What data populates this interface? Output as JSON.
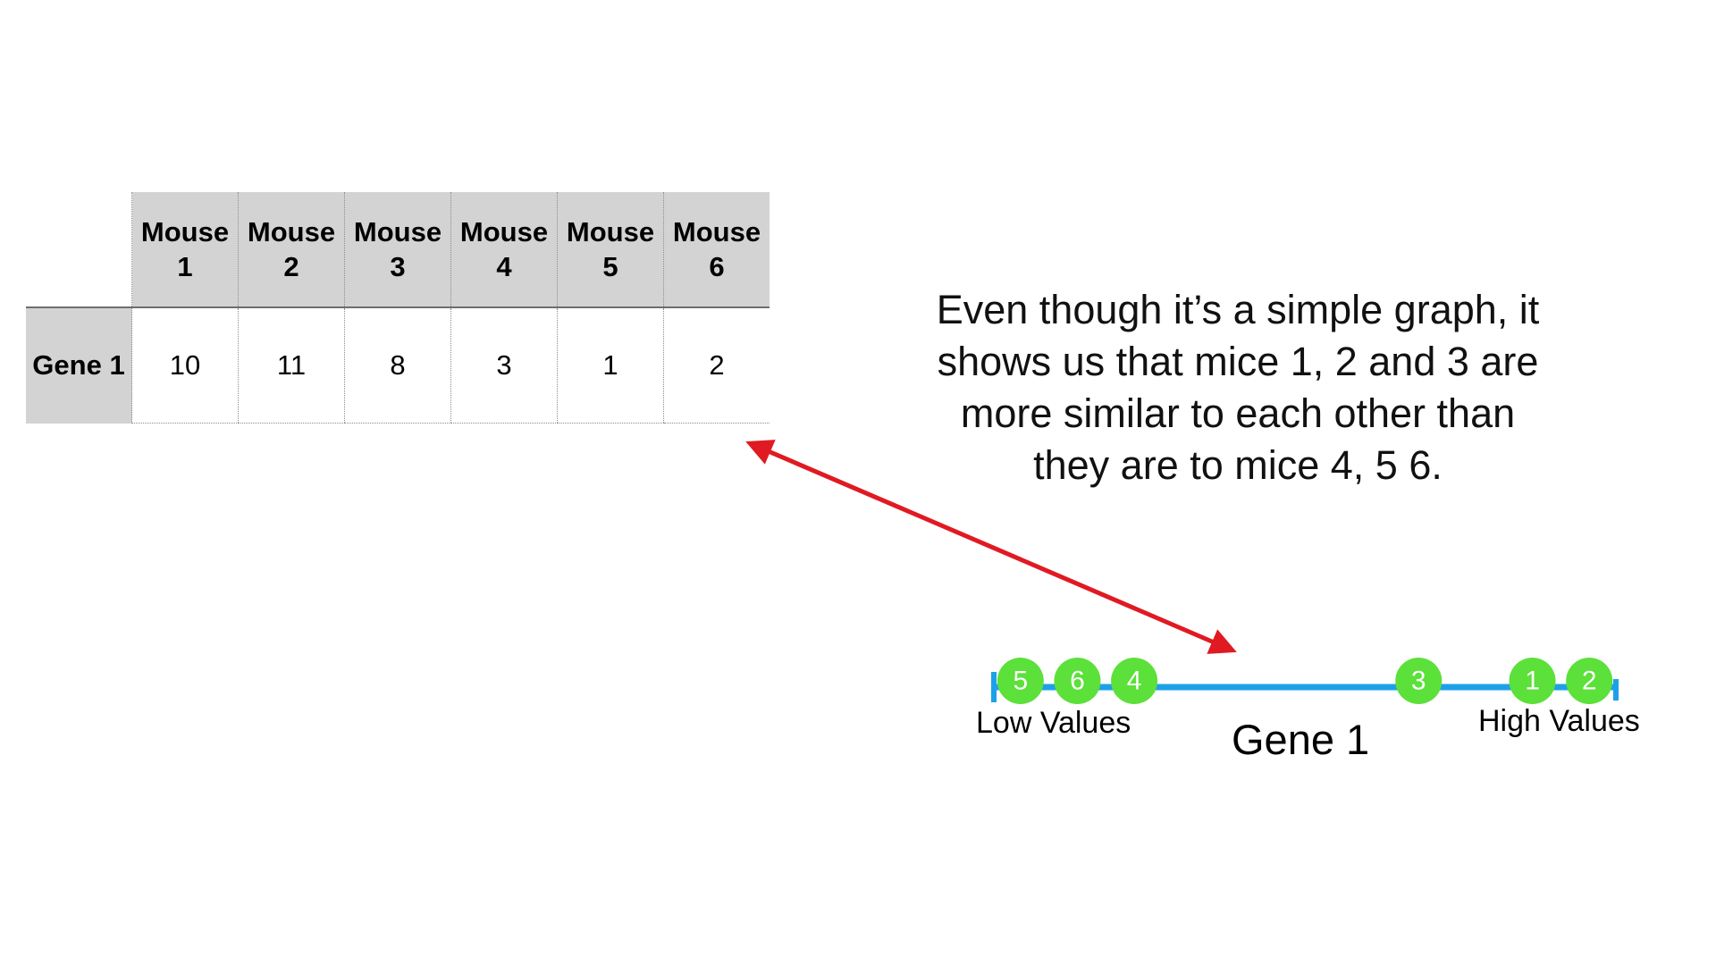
{
  "table": {
    "columns": [
      {
        "line1": "Mouse",
        "line2": "1"
      },
      {
        "line1": "Mouse",
        "line2": "2"
      },
      {
        "line1": "Mouse",
        "line2": "3"
      },
      {
        "line1": "Mouse",
        "line2": "4"
      },
      {
        "line1": "Mouse",
        "line2": "5"
      },
      {
        "line1": "Mouse",
        "line2": "6"
      }
    ],
    "row_label": "Gene 1",
    "values": [
      "10",
      "11",
      "8",
      "3",
      "1",
      "2"
    ]
  },
  "caption": "Even though it’s a simple graph, it shows us that mice 1, 2 and 3 are more similar to each other than they are to mice 4, 5 6.",
  "number_line": {
    "axis_label": "Gene 1",
    "low_label": "Low Values",
    "high_label": "High Values",
    "axis_min": 0.5,
    "axis_max": 11.5,
    "points": [
      {
        "label": "5",
        "value": 1
      },
      {
        "label": "6",
        "value": 2
      },
      {
        "label": "4",
        "value": 3
      },
      {
        "label": "3",
        "value": 8
      },
      {
        "label": "1",
        "value": 10
      },
      {
        "label": "2",
        "value": 11
      }
    ]
  },
  "colors": {
    "axis": "#1ea0e8",
    "point": "#5ce03a",
    "arrow": "#e01a22",
    "header_fill": "#d3d3d3"
  }
}
